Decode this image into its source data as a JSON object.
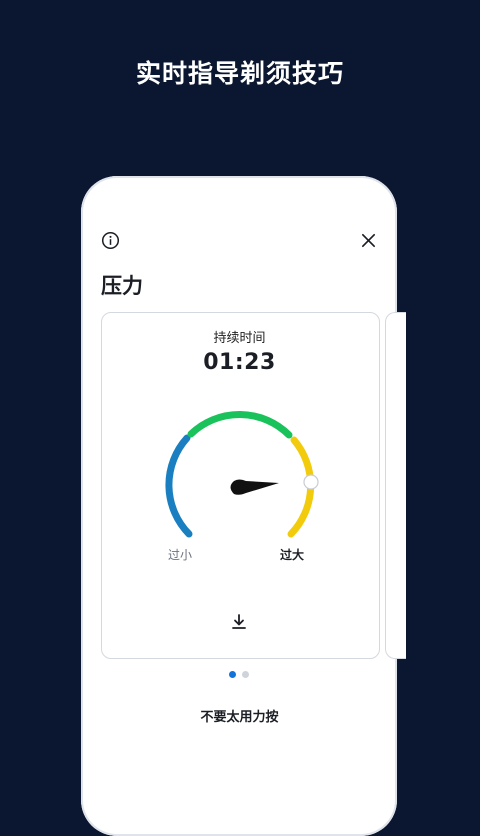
{
  "headline": "实时指导剃须技巧",
  "screen": {
    "title": "压力",
    "info_icon": "info-icon",
    "close_icon": "close-icon"
  },
  "card": {
    "duration_label": "持续时间",
    "duration_value": "01:23",
    "gauge": {
      "low_label": "过小",
      "high_label": "过大",
      "colors": {
        "low": "#1a7fc0",
        "ok": "#19c25a",
        "high": "#f2cc0c",
        "needle": "#111111"
      },
      "pressure_level": "high"
    },
    "download_icon": "download-icon"
  },
  "pagination": {
    "current": 1,
    "total": 2
  },
  "tip": "不要太用力按"
}
